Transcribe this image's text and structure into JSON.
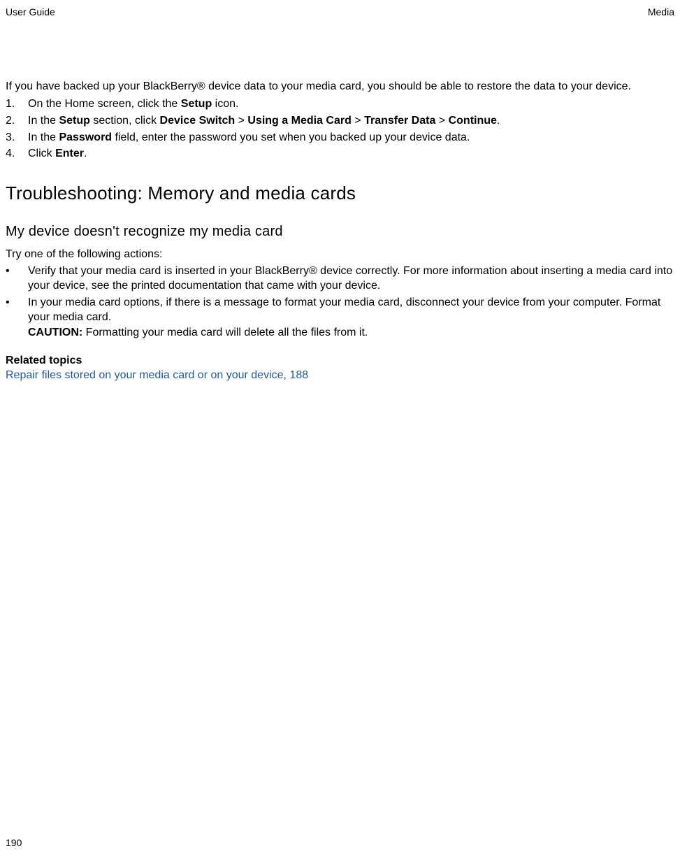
{
  "header": {
    "left": "User Guide",
    "right": "Media"
  },
  "intro": "If you have backed up your BlackBerry® device data to your media card, you should be able to restore the data to your device.",
  "steps": [
    {
      "n": "1.",
      "pre": "On the Home screen, click the ",
      "b1": "Setup",
      "post": " icon."
    },
    {
      "n": "2.",
      "pre": "In the ",
      "b1": "Setup",
      "mid1": " section, click ",
      "b2": "Device Switch",
      "mid2": " > ",
      "b3": "Using a Media Card",
      "mid3": " > ",
      "b4": "Transfer Data",
      "mid4": " > ",
      "b5": "Continue",
      "post": "."
    },
    {
      "n": "3.",
      "pre": "In the ",
      "b1": "Password",
      "post": " field, enter the password you set when you backed up your device data."
    },
    {
      "n": "4.",
      "pre": "Click ",
      "b1": "Enter",
      "post": "."
    }
  ],
  "h1": "Troubleshooting: Memory and media cards",
  "h2": "My device doesn't recognize my media card",
  "try_line": "Try one of the following actions:",
  "bullets": [
    {
      "text": "Verify that your media card is inserted in your BlackBerry® device correctly. For more information about inserting a media card into your device, see the printed documentation that came with your device."
    },
    {
      "text": "In your media card options, if there is a message to format your media card, disconnect your device from your computer. Format your media card.",
      "caution_label": "CAUTION:",
      "caution_text": " Formatting your media card will delete all the files from it."
    }
  ],
  "related_label": "Related topics",
  "related_link": "Repair files stored on your media card or on your device, 188",
  "page_number": "190"
}
